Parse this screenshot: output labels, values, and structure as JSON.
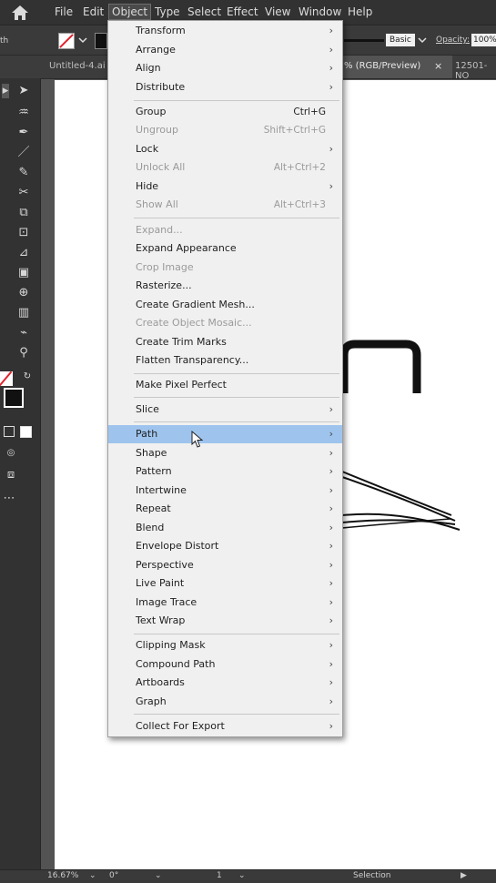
{
  "menubar": {
    "items": [
      "File",
      "Edit",
      "Object",
      "Type",
      "Select",
      "Effect",
      "View",
      "Window",
      "Help"
    ],
    "active": "Object"
  },
  "controlbar": {
    "left_label": "th",
    "style_label": "Basic",
    "opacity_label": "Opacity:",
    "opacity_value": "100%"
  },
  "tabs": {
    "tab1": "Untitled-4.ai",
    "tab2": "% (RGB/Preview)",
    "tab2_close": "×",
    "tab3": "12501-NO"
  },
  "menu": {
    "items": [
      {
        "label": "Transform",
        "shortcut": "",
        "submenu": true,
        "enabled": true
      },
      {
        "label": "Arrange",
        "shortcut": "",
        "submenu": true,
        "enabled": true
      },
      {
        "label": "Align",
        "shortcut": "",
        "submenu": true,
        "enabled": true
      },
      {
        "label": "Distribute",
        "shortcut": "",
        "submenu": true,
        "enabled": true
      },
      {
        "label": "Group",
        "shortcut": "Ctrl+G",
        "submenu": false,
        "enabled": true
      },
      {
        "label": "Ungroup",
        "shortcut": "Shift+Ctrl+G",
        "submenu": false,
        "enabled": false
      },
      {
        "label": "Lock",
        "shortcut": "",
        "submenu": true,
        "enabled": true
      },
      {
        "label": "Unlock All",
        "shortcut": "Alt+Ctrl+2",
        "submenu": false,
        "enabled": false
      },
      {
        "label": "Hide",
        "shortcut": "",
        "submenu": true,
        "enabled": true
      },
      {
        "label": "Show All",
        "shortcut": "Alt+Ctrl+3",
        "submenu": false,
        "enabled": false
      },
      {
        "label": "Expand...",
        "shortcut": "",
        "submenu": false,
        "enabled": false
      },
      {
        "label": "Expand Appearance",
        "shortcut": "",
        "submenu": false,
        "enabled": true
      },
      {
        "label": "Crop Image",
        "shortcut": "",
        "submenu": false,
        "enabled": false
      },
      {
        "label": "Rasterize...",
        "shortcut": "",
        "submenu": false,
        "enabled": true
      },
      {
        "label": "Create Gradient Mesh...",
        "shortcut": "",
        "submenu": false,
        "enabled": true
      },
      {
        "label": "Create Object Mosaic...",
        "shortcut": "",
        "submenu": false,
        "enabled": false
      },
      {
        "label": "Create Trim Marks",
        "shortcut": "",
        "submenu": false,
        "enabled": true
      },
      {
        "label": "Flatten Transparency...",
        "shortcut": "",
        "submenu": false,
        "enabled": true
      },
      {
        "label": "Make Pixel Perfect",
        "shortcut": "",
        "submenu": false,
        "enabled": true
      },
      {
        "label": "Slice",
        "shortcut": "",
        "submenu": true,
        "enabled": true
      },
      {
        "label": "Path",
        "shortcut": "",
        "submenu": true,
        "enabled": true
      },
      {
        "label": "Shape",
        "shortcut": "",
        "submenu": true,
        "enabled": true
      },
      {
        "label": "Pattern",
        "shortcut": "",
        "submenu": true,
        "enabled": true
      },
      {
        "label": "Intertwine",
        "shortcut": "",
        "submenu": true,
        "enabled": true
      },
      {
        "label": "Repeat",
        "shortcut": "",
        "submenu": true,
        "enabled": true
      },
      {
        "label": "Blend",
        "shortcut": "",
        "submenu": true,
        "enabled": true
      },
      {
        "label": "Envelope Distort",
        "shortcut": "",
        "submenu": true,
        "enabled": true
      },
      {
        "label": "Perspective",
        "shortcut": "",
        "submenu": true,
        "enabled": true
      },
      {
        "label": "Live Paint",
        "shortcut": "",
        "submenu": true,
        "enabled": true
      },
      {
        "label": "Image Trace",
        "shortcut": "",
        "submenu": true,
        "enabled": true
      },
      {
        "label": "Text Wrap",
        "shortcut": "",
        "submenu": true,
        "enabled": true
      },
      {
        "label": "Clipping Mask",
        "shortcut": "",
        "submenu": true,
        "enabled": true
      },
      {
        "label": "Compound Path",
        "shortcut": "",
        "submenu": true,
        "enabled": true
      },
      {
        "label": "Artboards",
        "shortcut": "",
        "submenu": true,
        "enabled": true
      },
      {
        "label": "Graph",
        "shortcut": "",
        "submenu": true,
        "enabled": true
      },
      {
        "label": "Collect For Export",
        "shortcut": "",
        "submenu": true,
        "enabled": true
      }
    ],
    "highlighted": "Path",
    "submenu_arrow": "›"
  },
  "statusbar": {
    "zoom": "16.67%",
    "rotation": "0°",
    "artboard_number": "1",
    "tool_name": "Selection"
  },
  "colors": {
    "menu_bg": "#f0f0f0",
    "highlight": "#9ec4ee",
    "ui_dark": "#323232",
    "stroke_none_red": "#e0212b"
  }
}
